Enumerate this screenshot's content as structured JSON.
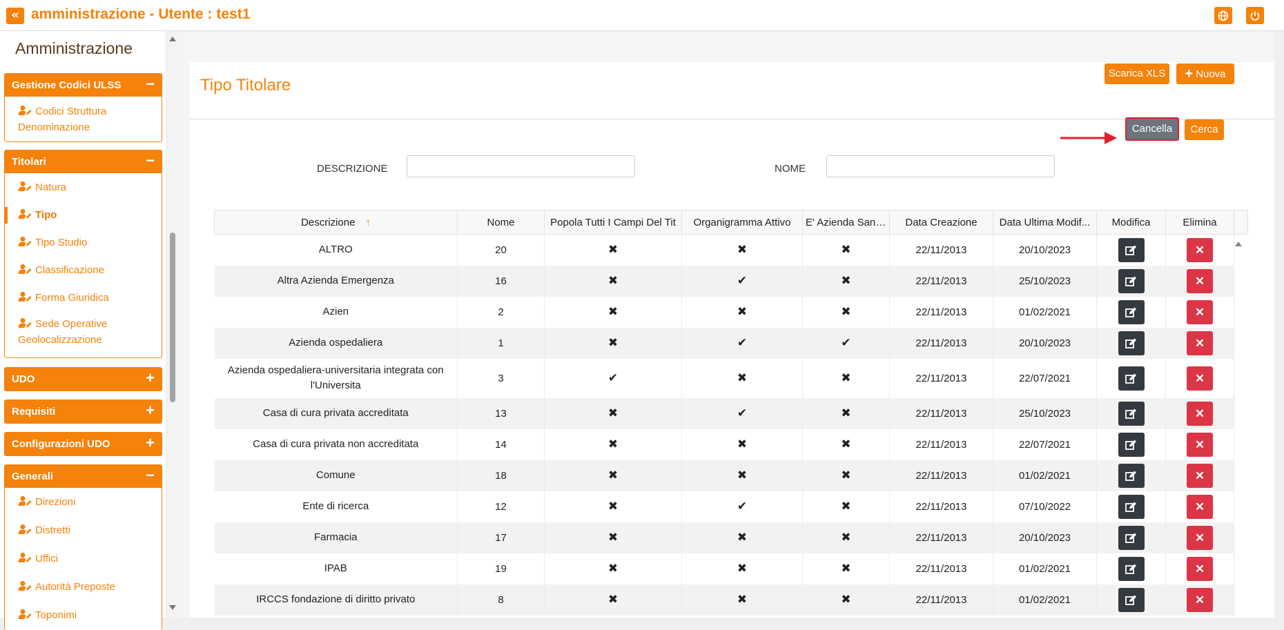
{
  "app": {
    "title": "amministrazione - Utente : test1",
    "collapse_glyph": "«"
  },
  "sidebar": {
    "heading": "Amministrazione",
    "panels": [
      {
        "title": "Gestione Codici ULSS",
        "toggle": "−",
        "items": [
          {
            "label": "Codici Struttura Denominazione"
          }
        ]
      },
      {
        "title": "Titolari",
        "toggle": "−",
        "items": [
          {
            "label": "Natura"
          },
          {
            "label": "Tipo",
            "active": true
          },
          {
            "label": "Tipo Studio"
          },
          {
            "label": "Classificazione"
          },
          {
            "label": "Forma Giuridica"
          },
          {
            "label": "Sede Operative Geolocalizzazione"
          }
        ]
      },
      {
        "title": "UDO",
        "toggle": "+"
      },
      {
        "title": "Requisiti",
        "toggle": "+"
      },
      {
        "title": "Configurazioni UDO",
        "toggle": "+"
      },
      {
        "title": "Generali",
        "toggle": "−",
        "items": [
          {
            "label": "Direzioni"
          },
          {
            "label": "Distretti"
          },
          {
            "label": "Uffici"
          },
          {
            "label": "Autorità Preposte"
          },
          {
            "label": "Toponimi"
          }
        ]
      }
    ]
  },
  "page": {
    "title": "Tipo Titolare",
    "buttons": {
      "download_xls": "Scarica XLS",
      "new": "Nuova",
      "cancel": "Cancella",
      "search": "Cerca"
    },
    "filters": {
      "descrizione_label": "DESCRIZIONE",
      "descrizione_value": "",
      "nome_label": "NOME",
      "nome_value": ""
    }
  },
  "table": {
    "sort_indicator": "↑",
    "columns": [
      "Descrizione",
      "Nome",
      "Popola Tutti I Campi Del Tit",
      "Organigramma Attivo",
      "E' Azienda Sani...",
      "Data Creazione",
      "Data Ultima Modif...",
      "Modifica",
      "Elimina"
    ],
    "rows": [
      {
        "descrizione": "ALTRO",
        "nome": "20",
        "popola": "✖",
        "organigramma": "✖",
        "azienda": "✖",
        "creazione": "22/11/2013",
        "modifica": "20/10/2023"
      },
      {
        "descrizione": "Altra Azienda Emergenza",
        "nome": "16",
        "popola": "✖",
        "organigramma": "✔",
        "azienda": "✖",
        "creazione": "22/11/2013",
        "modifica": "25/10/2023"
      },
      {
        "descrizione": "Azien",
        "nome": "2",
        "popola": "✖",
        "organigramma": "✖",
        "azienda": "✖",
        "creazione": "22/11/2013",
        "modifica": "01/02/2021"
      },
      {
        "descrizione": "Azienda ospedaliera",
        "nome": "1",
        "popola": "✖",
        "organigramma": "✔",
        "azienda": "✔",
        "creazione": "22/11/2013",
        "modifica": "20/10/2023"
      },
      {
        "descrizione": "Azienda ospedaliera-universitaria integrata con l'Universita",
        "nome": "3",
        "popola": "✔",
        "organigramma": "✖",
        "azienda": "✖",
        "creazione": "22/11/2013",
        "modifica": "22/07/2021"
      },
      {
        "descrizione": "Casa di cura privata accreditata",
        "nome": "13",
        "popola": "✖",
        "organigramma": "✔",
        "azienda": "✖",
        "creazione": "22/11/2013",
        "modifica": "25/10/2023"
      },
      {
        "descrizione": "Casa di cura privata non accreditata",
        "nome": "14",
        "popola": "✖",
        "organigramma": "✖",
        "azienda": "✖",
        "creazione": "22/11/2013",
        "modifica": "22/07/2021"
      },
      {
        "descrizione": "Comune",
        "nome": "18",
        "popola": "✖",
        "organigramma": "✖",
        "azienda": "✖",
        "creazione": "22/11/2013",
        "modifica": "01/02/2021"
      },
      {
        "descrizione": "Ente di ricerca",
        "nome": "12",
        "popola": "✖",
        "organigramma": "✔",
        "azienda": "✖",
        "creazione": "22/11/2013",
        "modifica": "07/10/2022"
      },
      {
        "descrizione": "Farmacia",
        "nome": "17",
        "popola": "✖",
        "organigramma": "✖",
        "azienda": "✖",
        "creazione": "22/11/2013",
        "modifica": "20/10/2023"
      },
      {
        "descrizione": "IPAB",
        "nome": "19",
        "popola": "✖",
        "organigramma": "✖",
        "azienda": "✖",
        "creazione": "22/11/2013",
        "modifica": "01/02/2021"
      },
      {
        "descrizione": "IRCCS fondazione di diritto privato",
        "nome": "8",
        "popola": "✖",
        "organigramma": "✖",
        "azienda": "✖",
        "creazione": "22/11/2013",
        "modifica": "01/02/2021"
      }
    ],
    "delete_glyph": "✕"
  },
  "icons": {
    "collapse": "double-chevron-left-icon",
    "language": "globe-icon",
    "logout": "power-icon",
    "menu_item": "user-edit-icon",
    "edit": "edit-icon",
    "delete": "close-icon",
    "new": "plus-icon"
  },
  "colors": {
    "accent": "#f5820b",
    "dark_button": "#343a40",
    "danger": "#dc3545",
    "grey_button": "#6c757d",
    "highlight_border": "#e0202e"
  }
}
